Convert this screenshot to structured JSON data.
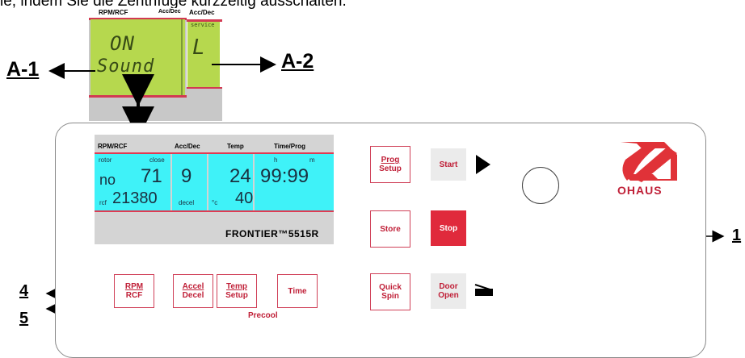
{
  "intro_text": "le, indem Sie die Zentrifuge kurzzeitig ausschalten.",
  "zoom": {
    "hdr_rpm": "RPM/RCF",
    "hdr_acc": "Acc/Dec",
    "line1": "ON",
    "line2": "Sound",
    "service_label": "service",
    "service_value": "L"
  },
  "callouts": {
    "a1": "A-1",
    "a2": "A-2",
    "n1": "1",
    "n4": "4",
    "n5": "5"
  },
  "lcd": {
    "hdr_rpm": "RPM/RCF",
    "hdr_acc": "Acc/Dec",
    "hdr_temp": "Temp",
    "hdr_time": "Time/Prog",
    "rotor_label": "rotor",
    "close_label": "close",
    "h_label": "h",
    "m_label": "m",
    "rotor_value": "no",
    "rotor_number": "71",
    "acc_value": "9",
    "temp_value": "24",
    "time_value": "99:99",
    "rcf_label": "rcf",
    "rcf_value": "21380",
    "decel_label": "decel",
    "celsius_label": "°c",
    "temp2_value": "40"
  },
  "model": "FRONTIER™5515R",
  "buttons": {
    "rpm": [
      "RPM",
      "RCF"
    ],
    "accel": [
      "Accel",
      "Decel"
    ],
    "temp": [
      "Temp",
      "Setup"
    ],
    "time": "Time",
    "precool": "Precool",
    "prog": [
      "Prog",
      "Setup"
    ],
    "start": "Start",
    "store": "Store",
    "stop": "Stop",
    "quick": [
      "Quick",
      "Spin"
    ],
    "door": [
      "Door",
      "Open"
    ]
  },
  "brand": "OHAUS",
  "colors": {
    "accent": "#c02038",
    "lcd_cyan": "#3ff2f8",
    "lcd_green": "#b6d84e",
    "stop_red": "#e02a3c"
  }
}
